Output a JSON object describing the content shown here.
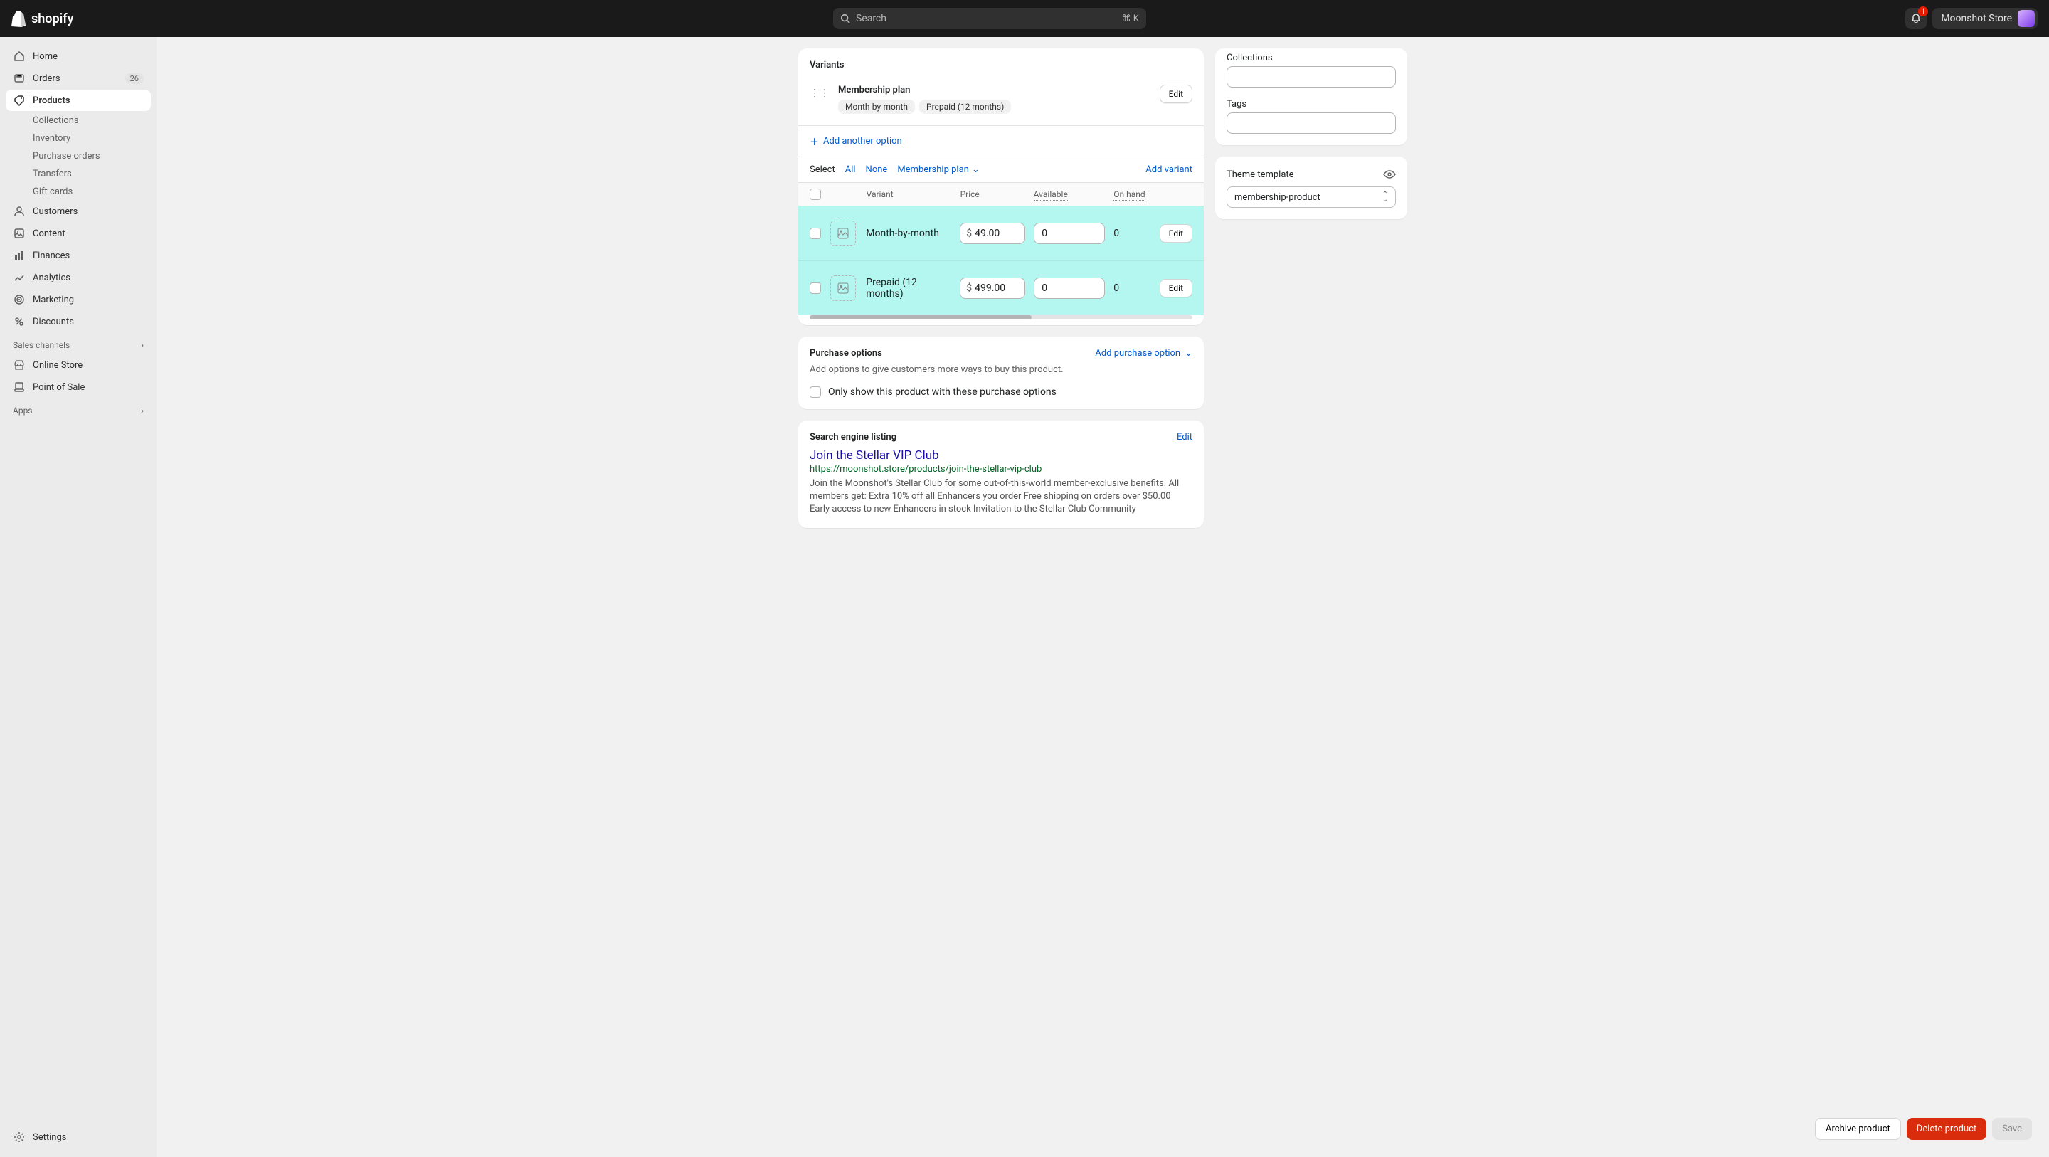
{
  "topbar": {
    "logo_text": "shopify",
    "search_placeholder": "Search",
    "search_shortcut": "⌘ K",
    "notifications_count": "1",
    "store_name": "Moonshot Store"
  },
  "sidebar": {
    "items": [
      {
        "label": "Home"
      },
      {
        "label": "Orders",
        "badge": "26"
      },
      {
        "label": "Products",
        "active": true
      },
      {
        "label": "Customers"
      },
      {
        "label": "Content"
      },
      {
        "label": "Finances"
      },
      {
        "label": "Analytics"
      },
      {
        "label": "Marketing"
      },
      {
        "label": "Discounts"
      }
    ],
    "product_subs": [
      "Collections",
      "Inventory",
      "Purchase orders",
      "Transfers",
      "Gift cards"
    ],
    "sections": {
      "sales_channels": "Sales channels",
      "online_store": "Online Store",
      "point_of_sale": "Point of Sale",
      "apps": "Apps"
    },
    "settings": "Settings"
  },
  "variants": {
    "card_title": "Variants",
    "option_name": "Membership plan",
    "edit_label": "Edit",
    "option_values": [
      "Month-by-month",
      "Prepaid (12 months)"
    ],
    "add_option": "Add another option",
    "select_label": "Select",
    "select_all": "All",
    "select_none": "None",
    "filter_label": "Membership plan",
    "add_variant": "Add variant",
    "columns": {
      "variant": "Variant",
      "price": "Price",
      "available": "Available",
      "on_hand": "On hand"
    },
    "rows": [
      {
        "name": "Month-by-month",
        "currency": "$",
        "price": "49.00",
        "available": "0",
        "on_hand": "0",
        "edit": "Edit"
      },
      {
        "name": "Prepaid (12 months)",
        "currency": "$",
        "price": "499.00",
        "available": "0",
        "on_hand": "0",
        "edit": "Edit"
      }
    ]
  },
  "purchase": {
    "title": "Purchase options",
    "add_label": "Add purchase option",
    "description": "Add options to give customers more ways to buy this product.",
    "checkbox_label": "Only show this product with these purchase options"
  },
  "seo": {
    "card_title": "Search engine listing",
    "edit": "Edit",
    "title": "Join the Stellar VIP Club",
    "url": "https://moonshot.store/products/join-the-stellar-vip-club",
    "description": "Join the Moonshot's Stellar Club for some out-of-this-world member-exclusive benefits. All members get: Extra 10% off all Enhancers you order Free shipping on orders over $50.00 Early access to new Enhancers in stock Invitation to the Stellar Club Community"
  },
  "side": {
    "collections_label": "Collections",
    "tags_label": "Tags",
    "theme_label": "Theme template",
    "theme_value": "membership-product"
  },
  "footer": {
    "archive": "Archive product",
    "delete": "Delete product",
    "save": "Save"
  }
}
